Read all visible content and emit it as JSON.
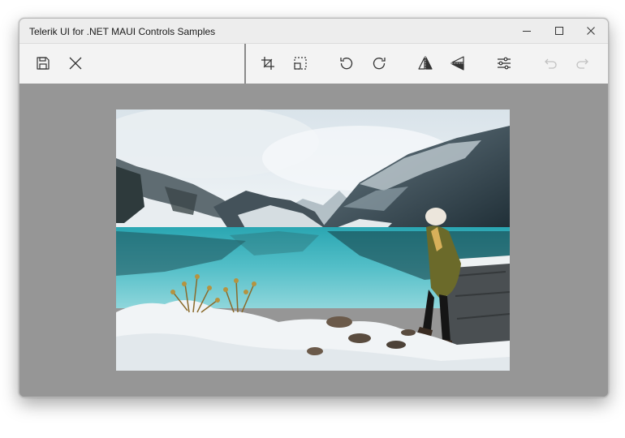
{
  "window": {
    "title": "Telerik UI for .NET MAUI Controls Samples",
    "controls": [
      {
        "name": "minimize",
        "icon": "minimize-icon"
      },
      {
        "name": "maximize",
        "icon": "maximize-icon"
      },
      {
        "name": "close",
        "icon": "close-icon"
      }
    ]
  },
  "toolbar": {
    "left_tools": [
      {
        "name": "save",
        "icon": "save-icon"
      },
      {
        "name": "close-image",
        "icon": "close-icon"
      }
    ],
    "right_tools": [
      {
        "name": "crop",
        "icon": "crop-icon"
      },
      {
        "name": "resize",
        "icon": "resize-icon"
      },
      {
        "name": "rotate-left",
        "icon": "rotate-left-icon"
      },
      {
        "name": "rotate-right",
        "icon": "rotate-right-icon"
      },
      {
        "name": "flip-horizontal",
        "icon": "flip-horizontal-icon"
      },
      {
        "name": "flip-vertical",
        "icon": "flip-vertical-icon"
      },
      {
        "name": "adjust",
        "icon": "sliders-icon"
      },
      {
        "name": "undo",
        "icon": "undo-icon",
        "disabled": true
      },
      {
        "name": "redo",
        "icon": "redo-icon",
        "disabled": true
      }
    ]
  },
  "colors": {
    "canvas_bg": "#969696",
    "toolbar_bg": "#f3f3f3",
    "title_bg": "#ededed",
    "icon": "#333333",
    "icon_disabled": "#9a9a9a"
  },
  "image": {
    "subject": "person in winter clothes sitting by a turquoise mountain lake with snowy mountains"
  }
}
